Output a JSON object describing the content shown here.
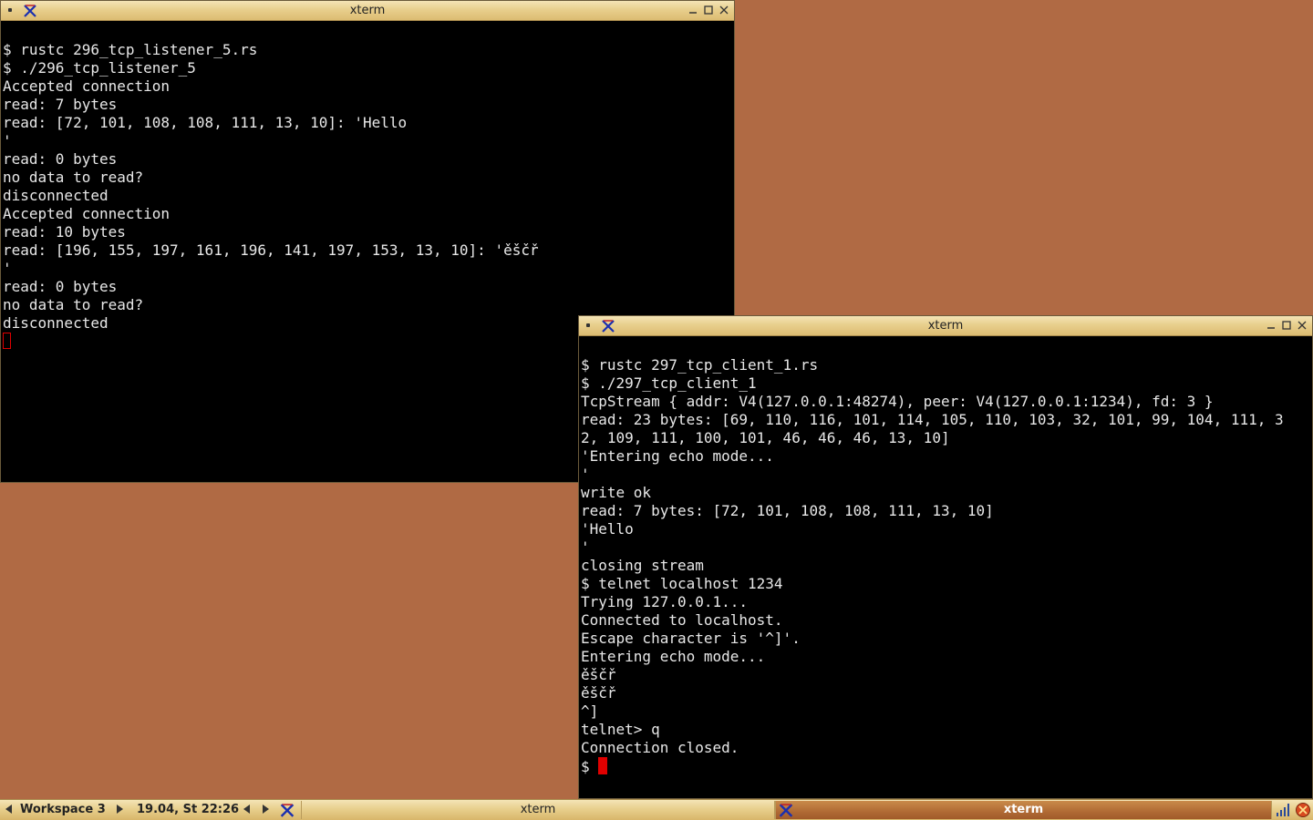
{
  "colors": {
    "desktop": "#b06a44",
    "terminal_bg": "#000000",
    "terminal_fg": "#e8e8e8",
    "cursor": "#e00000",
    "titlebar": "#e8cf8d",
    "active_task": "#b06a34"
  },
  "window_left": {
    "title": "xterm",
    "icons": [
      "menu-dot-icon",
      "xterm-x-icon",
      "minimize-icon",
      "maximize-icon",
      "close-icon"
    ],
    "lines": [
      "$ rustc 296_tcp_listener_5.rs",
      "$ ./296_tcp_listener_5",
      "Accepted connection",
      "read: 7 bytes",
      "read: [72, 101, 108, 108, 111, 13, 10]: 'Hello",
      "'",
      "read: 0 bytes",
      "no data to read?",
      "disconnected",
      "Accepted connection",
      "read: 10 bytes",
      "read: [196, 155, 197, 161, 196, 141, 197, 153, 13, 10]: 'ěščř",
      "'",
      "read: 0 bytes",
      "no data to read?",
      "disconnected"
    ]
  },
  "window_right": {
    "title": "xterm",
    "icons": [
      "menu-dot-icon",
      "xterm-x-icon",
      "minimize-icon",
      "maximize-icon",
      "close-icon"
    ],
    "lines": [
      "$ rustc 297_tcp_client_1.rs",
      "$ ./297_tcp_client_1",
      "TcpStream { addr: V4(127.0.0.1:48274), peer: V4(127.0.0.1:1234), fd: 3 }",
      "read: 23 bytes: [69, 110, 116, 101, 114, 105, 110, 103, 32, 101, 99, 104, 111, 3",
      "2, 109, 111, 100, 101, 46, 46, 46, 13, 10]",
      "'Entering echo mode...",
      "'",
      "write ok",
      "read: 7 bytes: [72, 101, 108, 108, 111, 13, 10]",
      "'Hello",
      "'",
      "closing stream",
      "$ telnet localhost 1234",
      "Trying 127.0.0.1...",
      "Connected to localhost.",
      "Escape character is '^]'.",
      "Entering echo mode...",
      "ěščř",
      "ěščř",
      "^]",
      "telnet> q",
      "Connection closed."
    ],
    "prompt": "$ "
  },
  "taskbar": {
    "workspace": "Workspace 3",
    "clock": "19.04, St 22:26",
    "tasks": [
      {
        "label": "xterm",
        "active": false
      },
      {
        "label": "xterm",
        "active": true
      }
    ],
    "icons": [
      "prev-workspace-icon",
      "next-workspace-icon",
      "prev-task-icon",
      "next-task-icon",
      "xterm-task-icon",
      "network-signal-icon",
      "power-icon"
    ]
  }
}
